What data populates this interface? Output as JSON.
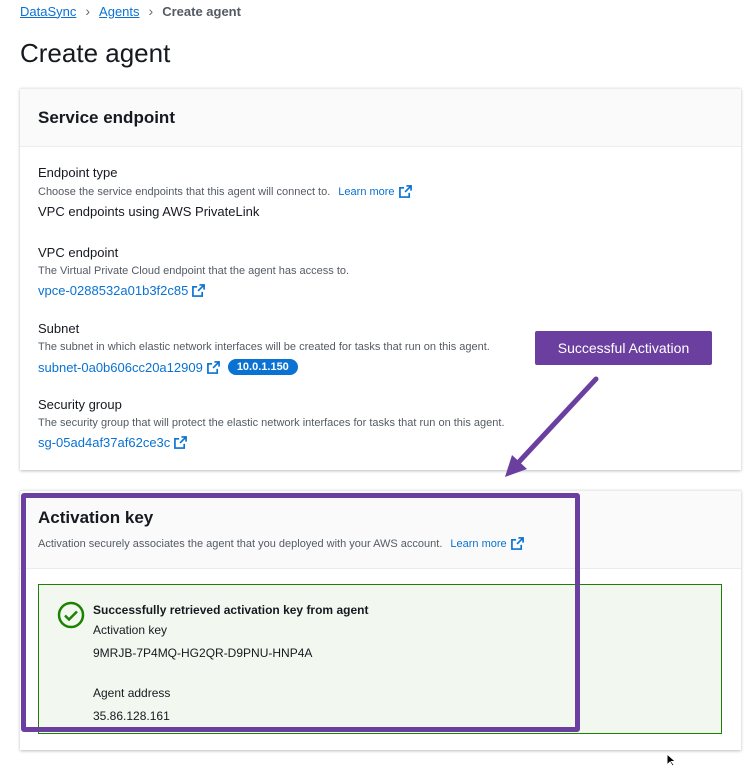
{
  "breadcrumb": {
    "items": [
      "DataSync",
      "Agents"
    ],
    "current": "Create agent"
  },
  "page": {
    "title": "Create agent"
  },
  "service_endpoint": {
    "title": "Service endpoint",
    "endpoint_type": {
      "label": "Endpoint type",
      "description": "Choose the service endpoints that this agent will connect to.",
      "learn_more": "Learn more",
      "value": "VPC endpoints using AWS PrivateLink"
    },
    "vpc_endpoint": {
      "label": "VPC endpoint",
      "description": "The Virtual Private Cloud endpoint that the agent has access to.",
      "value": "vpce-0288532a01b3f2c85"
    },
    "subnet": {
      "label": "Subnet",
      "description": "The subnet in which elastic network interfaces will be created for tasks that run on this agent.",
      "value": "subnet-0a0b606cc20a12909",
      "badge": "10.0.1.150"
    },
    "security_group": {
      "label": "Security group",
      "description": "The security group that will protect the elastic network interfaces for tasks that run on this agent.",
      "value": "sg-05ad4af37af62ce3c"
    }
  },
  "activation": {
    "title": "Activation key",
    "description": "Activation securely associates the agent that you deployed with your AWS account.",
    "learn_more": "Learn more",
    "success_title": "Successfully retrieved activation key from agent",
    "key_label": "Activation key",
    "key_value": "9MRJB-7P4MQ-HG2QR-D9PNU-HNP4A",
    "address_label": "Agent address",
    "address_value": "35.86.128.161"
  },
  "annotation": {
    "callout": "Successful Activation"
  },
  "colors": {
    "link": "#0972d3",
    "success_border": "#1d8102",
    "success_bg": "#f2f8f0",
    "annotation": "#6b3fa0"
  }
}
